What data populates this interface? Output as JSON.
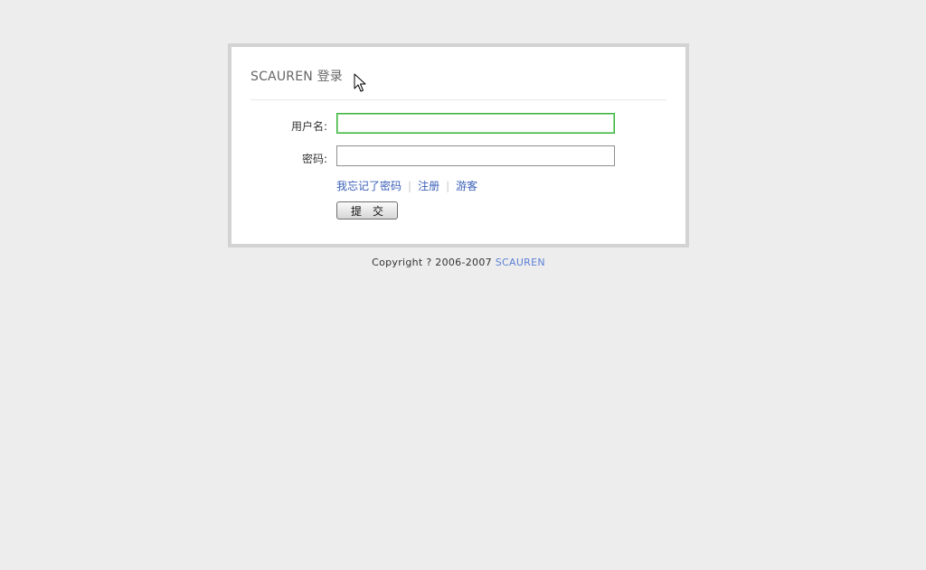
{
  "login": {
    "title": "SCAUREN 登录",
    "username_label": "用户名:",
    "username_value": "",
    "password_label": "密码:",
    "password_value": "",
    "links": {
      "forgot_password": "我忘记了密码",
      "separator": "|",
      "register": "注册",
      "guest": "游客"
    },
    "submit_label": "提　交"
  },
  "footer": {
    "copyright": "Copyright ? 2006-2007",
    "brand_link": "SCAUREN"
  },
  "colors": {
    "page_background": "#ededed",
    "box_border": "#d3d3d3",
    "link": "#3a5fb8",
    "focus_border": "#3bb33b"
  },
  "icons": {
    "cursor": "mouse-pointer-icon"
  }
}
